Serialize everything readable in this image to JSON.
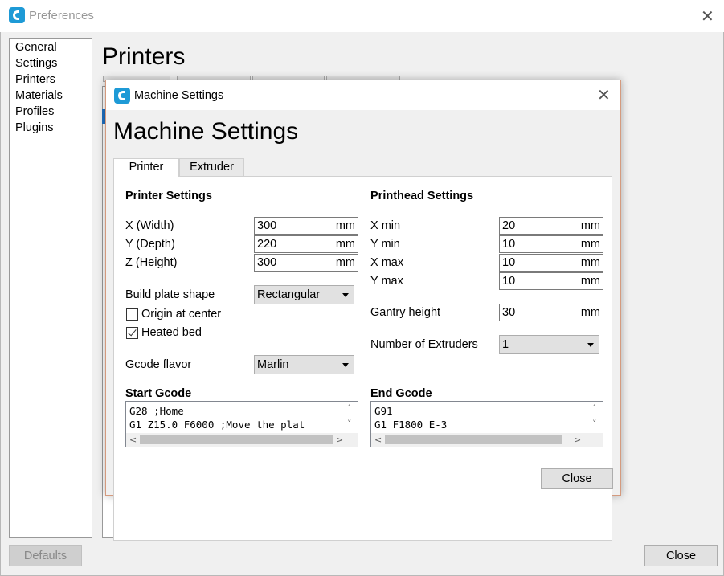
{
  "preferences": {
    "title": "Preferences",
    "close_icon": "✕",
    "heading": "Printers",
    "sidebar": [
      "General",
      "Settings",
      "Printers",
      "Materials",
      "Profiles",
      "Plugins"
    ],
    "defaults_label": "Defaults",
    "close_label": "Close"
  },
  "dialog": {
    "title": "Machine Settings",
    "heading": "Machine Settings",
    "close_icon": "✕",
    "tabs": [
      "Printer",
      "Extruder"
    ],
    "printer_settings": {
      "title": "Printer Settings",
      "x_label": "X (Width)",
      "x_value": "300",
      "y_label": "Y (Depth)",
      "y_value": "220",
      "z_label": "Z (Height)",
      "z_value": "300",
      "unit": "mm",
      "build_plate_label": "Build plate shape",
      "build_plate_value": "Rectangular",
      "origin_label": "Origin at center",
      "origin_checked": false,
      "heated_bed_label": "Heated bed",
      "heated_bed_checked": true,
      "gcode_flavor_label": "Gcode flavor",
      "gcode_flavor_value": "Marlin"
    },
    "printhead_settings": {
      "title": "Printhead Settings",
      "xmin_label": "X min",
      "xmin_value": "20",
      "ymin_label": "Y min",
      "ymin_value": "10",
      "xmax_label": "X max",
      "xmax_value": "10",
      "ymax_label": "Y max",
      "ymax_value": "10",
      "gantry_label": "Gantry height",
      "gantry_value": "30",
      "extruders_label": "Number of Extruders",
      "extruders_value": "1"
    },
    "start_gcode": {
      "title": "Start Gcode",
      "lines": [
        "G28 ;Home",
        "G1 Z15.0 F6000 ;Move the plat"
      ]
    },
    "end_gcode": {
      "title": "End Gcode",
      "lines": [
        "G91",
        "G1 F1800 E-3"
      ]
    },
    "close_label": "Close"
  }
}
